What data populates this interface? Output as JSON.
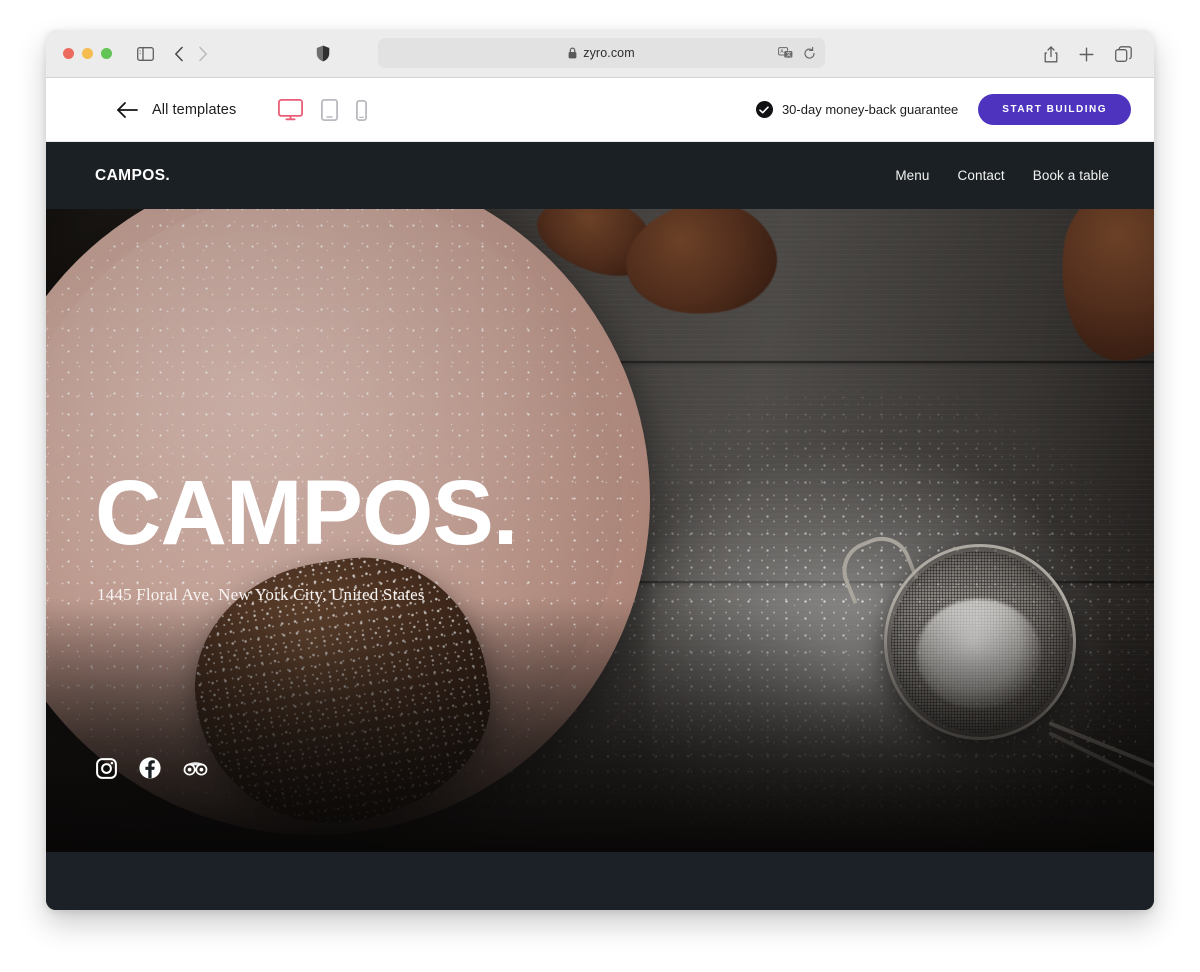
{
  "browser": {
    "url": "zyro.com",
    "lock_icon": "lock-icon",
    "traffic_lights": [
      "close",
      "minimize",
      "zoom"
    ],
    "toolbar_icons": [
      "sidebar-icon",
      "back-icon",
      "forward-icon",
      "shield-icon",
      "translate-icon",
      "reload-icon",
      "share-icon",
      "new-tab-icon",
      "tabs-icon"
    ]
  },
  "app_bar": {
    "back_label": "back-arrow-icon",
    "all_templates_label": "All templates",
    "devices": [
      {
        "name": "desktop",
        "active": true
      },
      {
        "name": "tablet",
        "active": false
      },
      {
        "name": "mobile",
        "active": false
      }
    ],
    "guarantee_text": "30-day money-back guarantee",
    "cta_label": "START BUILDING",
    "accent_purple": "#4e33bf",
    "accent_pink": "#ea5d77"
  },
  "site": {
    "logo": "CAMPOS.",
    "nav": [
      {
        "label": "Menu"
      },
      {
        "label": "Contact"
      },
      {
        "label": "Book a table"
      }
    ],
    "hero": {
      "title": "CAMPOS.",
      "address": "1445 Floral Ave. New York City, United States",
      "socials": [
        {
          "name": "instagram-icon"
        },
        {
          "name": "facebook-icon"
        },
        {
          "name": "tripadvisor-icon"
        }
      ]
    },
    "header_bg": "#1a2024",
    "footer_bg": "#1b2126"
  }
}
